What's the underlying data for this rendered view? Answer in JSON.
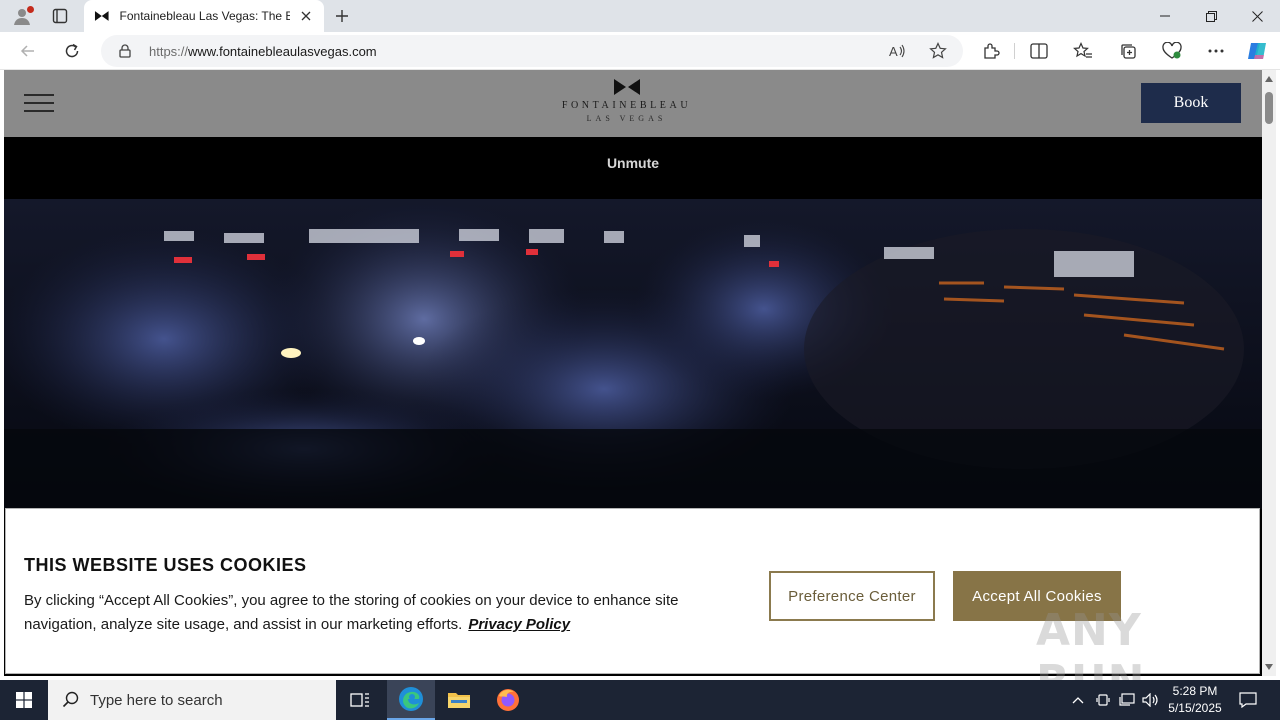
{
  "browser": {
    "tab_title": "Fontainebleau Las Vegas: The Best",
    "url_proto": "https://",
    "url_host": "www.fontainebleaulasvegas.com"
  },
  "site": {
    "logo_name": "FONTAINEBLEAU",
    "logo_sub": "LAS VEGAS",
    "book_label": "Book",
    "unmute_label": "Unmute"
  },
  "cookie": {
    "heading": "THIS WEBSITE USES COOKIES",
    "body": "By clicking “Accept All Cookies”, you agree to the storing of cookies on your device to enhance site navigation, analyze site usage, and assist in our marketing efforts.",
    "privacy_link": "Privacy Policy",
    "preference_label": "Preference Center",
    "accept_label": "Accept All Cookies",
    "watermark": "ANY RUN"
  },
  "taskbar": {
    "search_placeholder": "Type here to search",
    "time": "5:28 PM",
    "date": "5/15/2025"
  },
  "colors": {
    "book_bg": "#1e2c4b",
    "accept_bg": "#877447",
    "pref_border": "#8b7a4e"
  }
}
